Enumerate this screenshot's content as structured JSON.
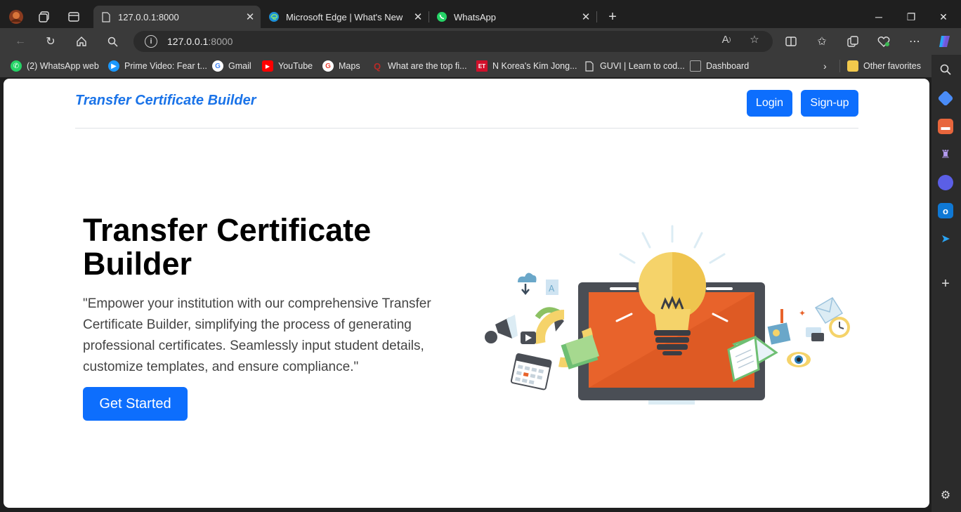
{
  "browser": {
    "tabs": [
      {
        "label": "127.0.0.1:8000",
        "active": true
      },
      {
        "label": "Microsoft Edge | What's New",
        "active": false
      },
      {
        "label": "WhatsApp",
        "active": false
      }
    ],
    "address": {
      "host": "127.0.0.1",
      "port": ":8000"
    },
    "bookmarks": [
      {
        "label": "(2) WhatsApp web",
        "icon": "whatsapp-icon",
        "color": "#25d366"
      },
      {
        "label": "Prime Video: Fear t...",
        "icon": "prime-video-icon",
        "color": "#1a98ff"
      },
      {
        "label": "Gmail",
        "icon": "google-icon",
        "color": "#4285f4"
      },
      {
        "label": "YouTube",
        "icon": "youtube-icon",
        "color": "#ff0000"
      },
      {
        "label": "Maps",
        "icon": "google-icon",
        "color": "#4285f4"
      },
      {
        "label": "What are the top fi...",
        "icon": "quora-icon",
        "color": "#b92b27"
      },
      {
        "label": "N Korea's Kim Jong...",
        "icon": "et-icon",
        "color": "#d0102b"
      },
      {
        "label": "GUVI | Learn to cod...",
        "icon": "page-icon",
        "color": "#cccccc"
      },
      {
        "label": "Dashboard",
        "icon": "page-icon",
        "color": "#cccccc"
      }
    ],
    "other_favorites": "Other favorites"
  },
  "page": {
    "brand": "Transfer Certificate Builder",
    "login_label": "Login",
    "signup_label": "Sign-up",
    "hero_title": "Transfer Certificate Builder",
    "hero_text": "\"Empower your institution with our comprehensive Transfer Certificate Builder, simplifying the process of generating professional certificates. Seamlessly input student details, customize templates, and ensure compliance.\"",
    "cta_label": "Get Started"
  },
  "colors": {
    "accent": "#0d6efd",
    "brand": "#1a73e8"
  }
}
